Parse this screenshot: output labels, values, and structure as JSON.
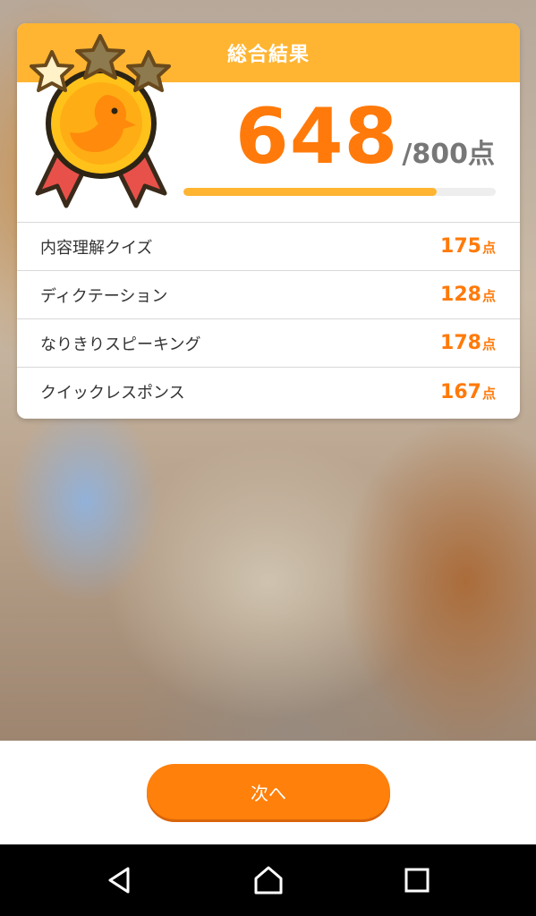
{
  "result_card": {
    "title": "総合結果",
    "total_score": "648",
    "max_score_text": "/800点",
    "progress": 0.81,
    "medal": {
      "icon": "gold-medal-icon",
      "stars_filled": 1,
      "stars_total": 3
    }
  },
  "breakdown": [
    {
      "label": "内容理解クイズ",
      "value": "175",
      "unit": "点"
    },
    {
      "label": "ディクテーション",
      "value": "128",
      "unit": "点"
    },
    {
      "label": "なりきりスピーキング",
      "value": "178",
      "unit": "点"
    },
    {
      "label": "クイックレスポンス",
      "value": "167",
      "unit": "点"
    }
  ],
  "next_button": {
    "label": "次へ"
  },
  "nav_bar": {
    "icons": [
      "back-triangle-icon",
      "home-icon",
      "recents-square-icon"
    ]
  },
  "colors": {
    "accent_orange": "#ff7a0a",
    "header_yellow": "#ffb532",
    "button_orange": "#ff800b"
  }
}
